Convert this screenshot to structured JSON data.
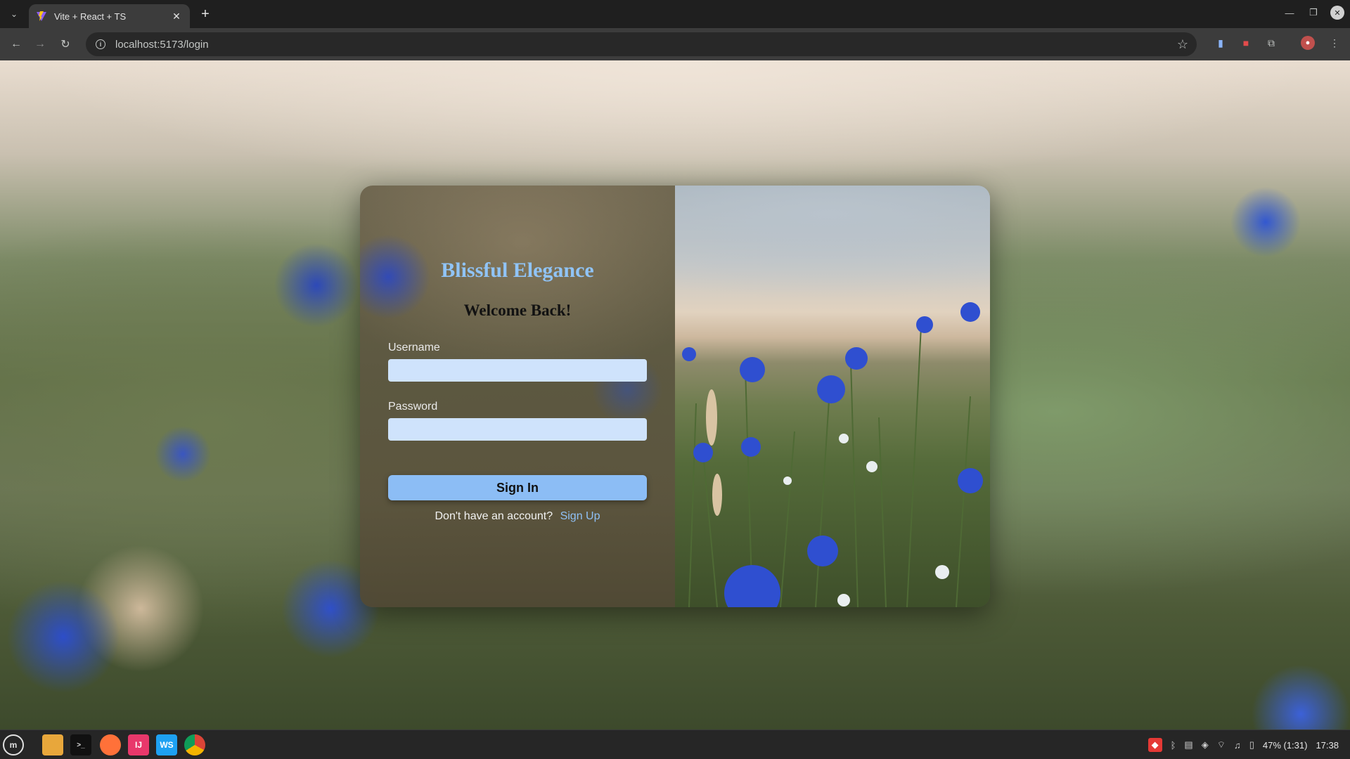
{
  "browser": {
    "tab_title": "Vite + React + TS",
    "url": "localhost:5173/login",
    "new_tab_symbol": "+",
    "close_symbol": "✕"
  },
  "page": {
    "brand": "Blissful Elegance",
    "welcome": "Welcome Back!",
    "username_label": "Username",
    "username_value": "",
    "password_label": "Password",
    "password_value": "",
    "signin_label": "Sign In",
    "signup_prompt": "Don't have an account?",
    "signup_link": "Sign Up"
  },
  "taskbar": {
    "battery": "47% (1:31)",
    "time": "17:38"
  },
  "colors": {
    "brand": "#90c4f7",
    "input_bg": "#cfe3fc",
    "button_bg": "#8cbdf5",
    "link": "#8fc0f5",
    "chrome_bg": "#3c3c3c"
  },
  "icons": [
    "tab-list-icon",
    "vite-favicon-icon",
    "back-icon",
    "forward-icon",
    "reload-icon",
    "info-icon",
    "star-icon",
    "extension-icon",
    "profile-avatar-icon",
    "menu-icon",
    "linux-mint-menu-icon",
    "files-icon",
    "terminal-icon",
    "firefox-icon",
    "intellij-icon",
    "webstorm-icon",
    "chrome-icon",
    "wifi-icon",
    "battery-icon"
  ]
}
